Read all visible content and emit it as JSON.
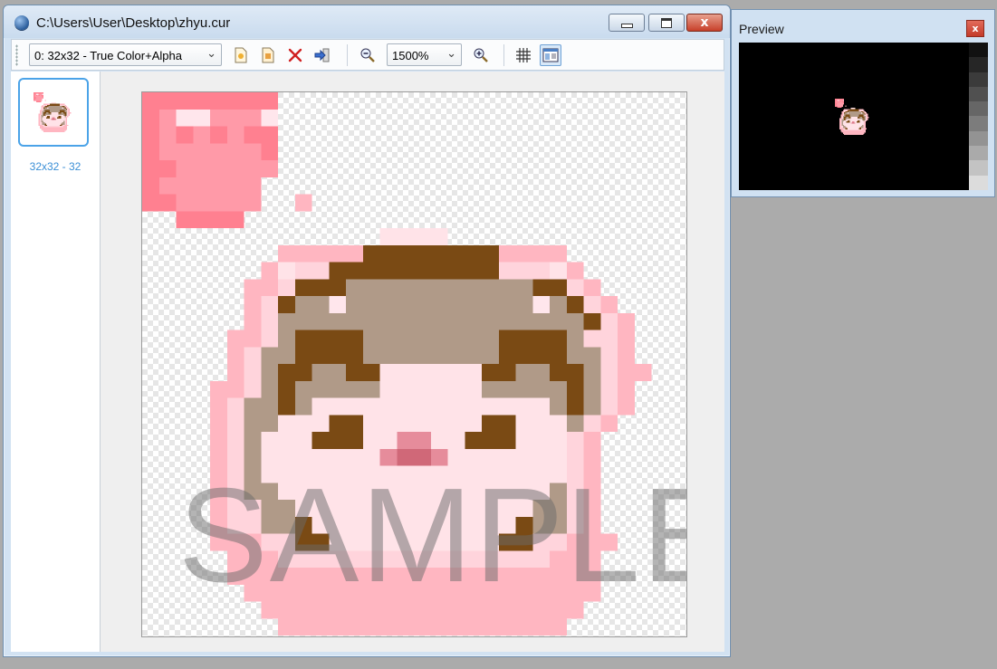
{
  "window": {
    "title": "C:\\Users\\User\\Desktop\\zhyu.cur",
    "close_glyph": "x"
  },
  "toolbar": {
    "frame_select": "0: 32x32 - True Color+Alpha",
    "zoom_select": "1500%",
    "icons": [
      "new-frame-icon",
      "edit-frame-icon",
      "delete-frame-icon",
      "export-frame-icon",
      "zoom-out-icon",
      "zoom-in-icon",
      "grid-icon",
      "preview-toggle-icon"
    ]
  },
  "frames": [
    {
      "label": "32x32 - 32"
    }
  ],
  "canvas": {
    "watermark": "SAMPLE",
    "pixel_rows": [
      "HHHHHHHH........................",
      "HGIIGGGI........................",
      "HGHGHGHH........................",
      "HGGGGGGH........................",
      "HHGGGGGG........................",
      "HGGGGGG.........................",
      "HHGGGGG..A......................",
      "..HHHH..........................",
      "..............CCCC..............",
      "........AAAAAMMMMMMMMAAAA.......",
      ".......ACBBMMMMMMMMMMBBBCA.......",
      "......AABMMMNNNNNNNNNNNMMBA.....",
      "......ABMNNINNNNNNNNNNNINMBA....",
      "......ABNNNNNNNNNNNNNNNNNNMBA...",
      ".....AABNMMMMNNNNNNNNMMMMNBBA...",
      ".....ABNNMMMMNNNNNNNNMMMMNNBA...",
      ".....ABNMMNNMMCCCCCCMMNNMMNBAA..",
      "....AABNMNNNNNCCCCCCNNNNNMNBA...",
      "....ABNNMNCCCCCCCCCCCCCCNMNBA...",
      "....ABNNCCCMMCCCCCCCMMCCCNBA....",
      "....ABNCCCMMMCCEECCMMMCCCBA.....",
      "....ABNCCCCCCCEFFECCCCCCCBA.....",
      "....ABNCCCCCCCCCCCCCCCCCCBA.....",
      "....ABNNCCCCCCCCCCCCCCCCNBA.....",
      "....ABBNNCCCCCCCCCCCCCCNNBA.....",
      "....ABBNNMCCCCCCCCCCCCMNNBA.....",
      "....AAABBMMCCCCCCCCCCMMBBAAA....",
      ".....AAABBBBBBBBBBBBBBBBAAA.....",
      ".....AAAAAAAAAAAAAAAAAAAAAA.....",
      "......AAAAAAAAAAAAAAAAAAAAA.....",
      ".......AAAAAAAAAAAAAAAAAAA......",
      "........AAAAAAAAAAAAAAAAA......."
    ],
    "palette": {
      "A": "#ffb6c1",
      "B": "#ffd4dc",
      "C": "#ffe3e8",
      "E": "#e68c9b",
      "F": "#d06878",
      "G": "#ff9aa8",
      "H": "#ff8090",
      "I": "#ffe6ec",
      "M": "#7a4a14",
      "N": "#b09a88"
    }
  },
  "preview": {
    "title": "Preview",
    "close_glyph": "x",
    "grayscale": [
      "#111111",
      "#262626",
      "#3b3b3b",
      "#505050",
      "#666666",
      "#7c7c7c",
      "#939393",
      "#aaaaaa",
      "#c3c3c3",
      "#dcdcdc"
    ]
  }
}
